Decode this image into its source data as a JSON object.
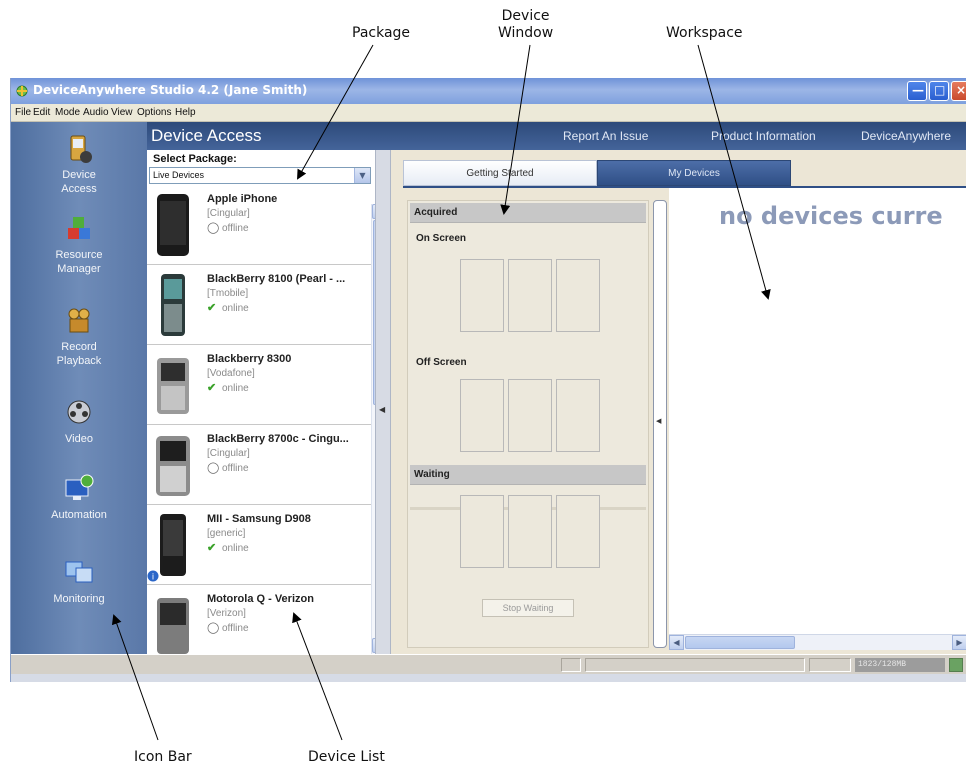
{
  "annotations": {
    "package": "Package",
    "device_window_line1": "Device",
    "device_window_line2": "Window",
    "workspace": "Workspace",
    "icon_bar": "Icon Bar",
    "device_list": "Device List"
  },
  "window": {
    "title": "DeviceAnywhere Studio 4.2 (Jane Smith)",
    "menu": [
      "File",
      "Edit",
      "Mode",
      "Audio",
      "View",
      "Options",
      "Help"
    ]
  },
  "header": {
    "title": "Device Access",
    "links": [
      "Report An Issue",
      "Product Information",
      "DeviceAnywhere"
    ]
  },
  "icon_bar": {
    "items": [
      {
        "label_line1": "Device",
        "label_line2": "Access",
        "icon": "phone-icon"
      },
      {
        "label_line1": "Resource",
        "label_line2": "Manager",
        "icon": "cubes-icon"
      },
      {
        "label_line1": "Record",
        "label_line2": "Playback",
        "icon": "film-camera-icon"
      },
      {
        "label_line1": "Video",
        "label_line2": "",
        "icon": "film-reel-icon"
      },
      {
        "label_line1": "Automation",
        "label_line2": "",
        "icon": "monitor-icon"
      },
      {
        "label_line1": "Monitoring",
        "label_line2": "",
        "icon": "screens-icon"
      }
    ]
  },
  "package": {
    "label": "Select Package:",
    "selected": "Live Devices"
  },
  "devices": [
    {
      "name": "Apple iPhone",
      "carrier": "[Cingular]",
      "status": "offline"
    },
    {
      "name": "BlackBerry 8100 (Pearl - ...",
      "carrier": "[Tmobile]",
      "status": "online"
    },
    {
      "name": "Blackberry 8300",
      "carrier": "[Vodafone]",
      "status": "online"
    },
    {
      "name": "BlackBerry 8700c - Cingu...",
      "carrier": "[Cingular]",
      "status": "offline"
    },
    {
      "name": "MII - Samsung D908",
      "carrier": "[generic]",
      "status": "online"
    },
    {
      "name": "Motorola Q - Verizon",
      "carrier": "[Verizon]",
      "status": "offline"
    }
  ],
  "tabs": [
    "Getting Started",
    "My Devices"
  ],
  "device_window": {
    "acquired": "Acquired",
    "on_screen": "On Screen",
    "off_screen": "Off Screen",
    "waiting": "Waiting",
    "stop_waiting": "Stop Waiting"
  },
  "workspace": {
    "message": "no devices curre"
  },
  "statusbar": {
    "memory": "1823/128MB"
  },
  "colors": {
    "header_blue": "#2d4a7a",
    "icon_bar": "#5a78a8",
    "online_green": "#3aa22a",
    "workspace_text": "#8c9ab8"
  }
}
